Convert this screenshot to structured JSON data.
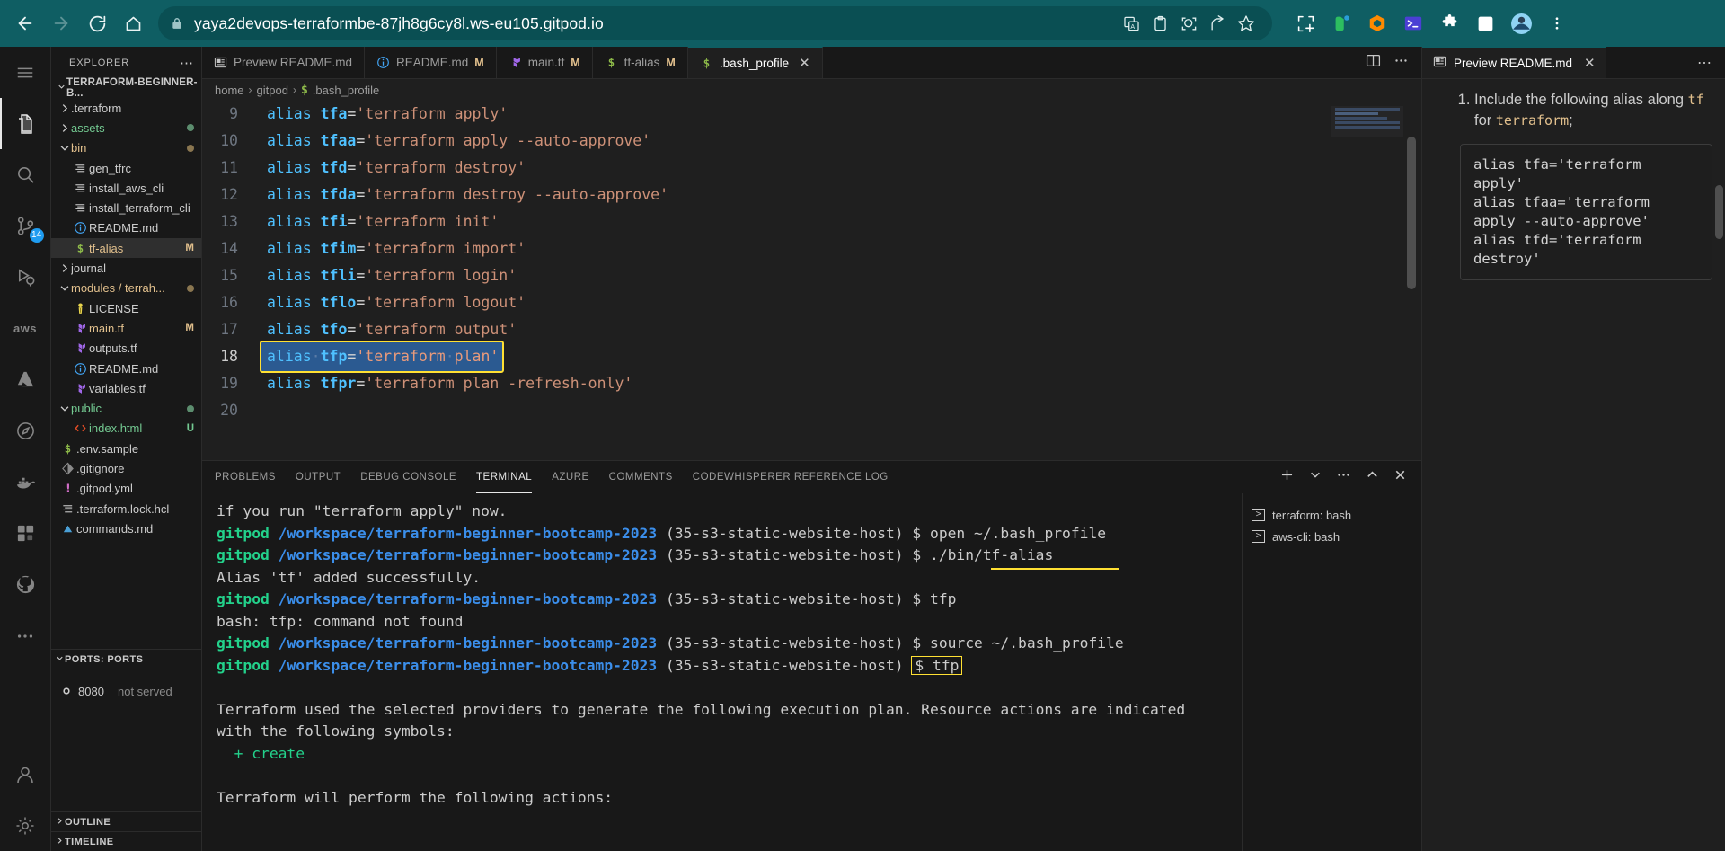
{
  "browser": {
    "url": "yaya2devops-terraformbe-87jh8g6cy8l.ws-eu105.gitpod.io",
    "back_label": "back-arrow",
    "forward_label": "forward-arrow",
    "reload_label": "reload",
    "home_label": "home",
    "icons": [
      "translate-icon",
      "clipboard-icon",
      "lens-icon",
      "share-icon",
      "star-icon",
      "screenshot-icon",
      "evernote-icon",
      "gitpod-icon",
      "terminal-ext-icon",
      "puzzle-icon",
      "sidepanel-icon",
      "profile-avatar-icon",
      "kebab-menu-icon"
    ]
  },
  "activity_bar": {
    "items": [
      {
        "name": "menu",
        "icon": "hamburger-icon"
      },
      {
        "name": "explorer",
        "icon": "files-icon",
        "active": true
      },
      {
        "name": "search",
        "icon": "search-icon"
      },
      {
        "name": "source-control",
        "icon": "source-control-icon",
        "badge": "14"
      },
      {
        "name": "run-debug",
        "icon": "run-debug-icon"
      },
      {
        "name": "aws",
        "icon": "aws-icon",
        "label": "aws"
      },
      {
        "name": "azure",
        "icon": "azure-icon"
      },
      {
        "name": "docker",
        "icon": "docker-icon"
      },
      {
        "name": "coffee",
        "icon": "java-icon"
      },
      {
        "name": "extensions",
        "icon": "extensions-icon"
      },
      {
        "name": "remote",
        "icon": "remote-explorer-icon"
      },
      {
        "name": "more",
        "icon": "ellipsis-icon"
      },
      {
        "name": "accounts",
        "icon": "account-icon"
      },
      {
        "name": "settings",
        "icon": "gear-icon"
      }
    ]
  },
  "sidebar": {
    "title": "EXPLORER",
    "more_label": "⋯",
    "root": "TERRAFORM-BEGINNER-B...",
    "tree": [
      {
        "label": ".terraform",
        "icon": "chevron-right",
        "indent": 1,
        "kind": "folder",
        "color": "white"
      },
      {
        "label": "assets",
        "icon": "chevron-right",
        "indent": 1,
        "kind": "folder",
        "color": "green",
        "dot": "#5c8d6e"
      },
      {
        "label": "bin",
        "icon": "chevron-down",
        "indent": 1,
        "kind": "folder",
        "color": "orange",
        "dot": "#8a7650"
      },
      {
        "label": "gen_tfrc",
        "icon": "script-icon",
        "indent": 2,
        "kind": "file",
        "color": "white"
      },
      {
        "label": "install_aws_cli",
        "icon": "script-icon",
        "indent": 2,
        "kind": "file",
        "color": "white"
      },
      {
        "label": "install_terraform_cli",
        "icon": "script-icon",
        "indent": 2,
        "kind": "file",
        "color": "white"
      },
      {
        "label": "README.md",
        "icon": "info-icon",
        "indent": 2,
        "kind": "file",
        "color": "white"
      },
      {
        "label": "tf-alias",
        "icon": "shell-icon",
        "indent": 2,
        "kind": "file",
        "color": "orange",
        "badge": "M",
        "selected": true
      },
      {
        "label": "journal",
        "icon": "chevron-right",
        "indent": 1,
        "kind": "folder",
        "color": "white"
      },
      {
        "label": "modules / terrah...",
        "icon": "chevron-down",
        "indent": 1,
        "kind": "folder",
        "color": "orange",
        "dot": "#8a7650"
      },
      {
        "label": "LICENSE",
        "icon": "license-icon",
        "indent": 2,
        "kind": "file",
        "color": "white"
      },
      {
        "label": "main.tf",
        "icon": "terraform-icon",
        "indent": 2,
        "kind": "file",
        "color": "orange",
        "badge": "M"
      },
      {
        "label": "outputs.tf",
        "icon": "terraform-icon",
        "indent": 2,
        "kind": "file",
        "color": "white"
      },
      {
        "label": "README.md",
        "icon": "info-icon",
        "indent": 2,
        "kind": "file",
        "color": "white"
      },
      {
        "label": "variables.tf",
        "icon": "terraform-icon",
        "indent": 2,
        "kind": "file",
        "color": "white"
      },
      {
        "label": "public",
        "icon": "chevron-down",
        "indent": 1,
        "kind": "folder",
        "color": "green",
        "dot": "#5c8d6e"
      },
      {
        "label": "index.html",
        "icon": "html-icon",
        "indent": 2,
        "kind": "file",
        "color": "green",
        "badge": "U"
      },
      {
        "label": ".env.sample",
        "icon": "shell-icon",
        "indent": 1,
        "kind": "file",
        "color": "white"
      },
      {
        "label": ".gitignore",
        "icon": "git-icon",
        "indent": 1,
        "kind": "file",
        "color": "white"
      },
      {
        "label": ".gitpod.yml",
        "icon": "yaml-icon",
        "indent": 1,
        "kind": "file",
        "color": "white"
      },
      {
        "label": ".terraform.lock.hcl",
        "icon": "script-icon",
        "indent": 1,
        "kind": "file",
        "color": "white"
      },
      {
        "label": "commands.md",
        "icon": "markdown-icon",
        "indent": 1,
        "kind": "file",
        "color": "white"
      }
    ],
    "ports_header": "PORTS: PORTS",
    "ports": [
      {
        "port": "8080",
        "status": "not served"
      }
    ],
    "outline_header": "OUTLINE",
    "timeline_header": "TIMELINE"
  },
  "editor": {
    "tabs": [
      {
        "label": "Preview README.md",
        "icon": "preview-icon",
        "modified": "",
        "active": false,
        "closable": false
      },
      {
        "label": "README.md",
        "icon": "info-icon",
        "modified": "M",
        "active": false,
        "closable": false
      },
      {
        "label": "main.tf",
        "icon": "terraform-icon",
        "modified": "M",
        "active": false,
        "closable": false
      },
      {
        "label": "tf-alias",
        "icon": "shell-icon",
        "modified": "M",
        "active": false,
        "closable": false
      },
      {
        "label": ".bash_profile",
        "icon": "shell-icon",
        "modified": "",
        "active": true,
        "closable": true
      }
    ],
    "tab_close_glyph": "✕",
    "split_editor_label": "split-editor",
    "more_actions_label": "⋯",
    "breadcrumb": [
      "home",
      "gitpod",
      ".bash_profile"
    ],
    "breadcrumb_icon": "shell-icon",
    "lines": [
      {
        "n": "9",
        "kw": "alias",
        "var": "tfa",
        "str": "'terraform apply'"
      },
      {
        "n": "10",
        "kw": "alias",
        "var": "tfaa",
        "str": "'terraform apply --auto-approve'"
      },
      {
        "n": "11",
        "kw": "alias",
        "var": "tfd",
        "str": "'terraform destroy'"
      },
      {
        "n": "12",
        "kw": "alias",
        "var": "tfda",
        "str": "'terraform destroy --auto-approve'"
      },
      {
        "n": "13",
        "kw": "alias",
        "var": "tfi",
        "str": "'terraform init'"
      },
      {
        "n": "14",
        "kw": "alias",
        "var": "tfim",
        "str": "'terraform import'"
      },
      {
        "n": "15",
        "kw": "alias",
        "var": "tfli",
        "str": "'terraform login'"
      },
      {
        "n": "16",
        "kw": "alias",
        "var": "tflo",
        "str": "'terraform logout'"
      },
      {
        "n": "17",
        "kw": "alias",
        "var": "tfo",
        "str": "'terraform output'"
      },
      {
        "n": "18",
        "kw": "alias",
        "var": "tfp",
        "str": "'terraform plan'",
        "selected": true
      },
      {
        "n": "19",
        "kw": "alias",
        "var": "tfpr",
        "str": "'terraform plan -refresh-only'"
      },
      {
        "n": "20",
        "kw": "",
        "var": "",
        "str": ""
      }
    ]
  },
  "panel": {
    "tabs": [
      {
        "label": "PROBLEMS",
        "active": false
      },
      {
        "label": "OUTPUT",
        "active": false
      },
      {
        "label": "DEBUG CONSOLE",
        "active": false
      },
      {
        "label": "TERMINAL",
        "active": true
      },
      {
        "label": "AZURE",
        "active": false
      },
      {
        "label": "COMMENTS",
        "active": false
      },
      {
        "label": "CODEWHISPERER REFERENCE LOG",
        "active": false
      }
    ],
    "actions": [
      "add-terminal-icon",
      "chevron-down-icon",
      "ellipsis-icon",
      "maximize-panel-icon",
      "close-panel-icon"
    ],
    "terminal": {
      "user": "gitpod",
      "path": "/workspace/terraform-beginner-bootcamp-2023",
      "branch": "(35-s3-static-website-host)",
      "prompt": "$",
      "lines": [
        {
          "type": "plain",
          "text": "if you run \"terraform apply\" now."
        },
        {
          "type": "prompt",
          "cmd": "open ~/.bash_profile"
        },
        {
          "type": "prompt",
          "cmd": "./bin/tf-alias",
          "underline": true
        },
        {
          "type": "plain",
          "text": "Alias 'tf' added successfully."
        },
        {
          "type": "prompt",
          "cmd": "tfp"
        },
        {
          "type": "plain",
          "text": "bash: tfp: command not found"
        },
        {
          "type": "prompt",
          "cmd": "source ~/.bash_profile",
          "underline": true
        },
        {
          "type": "prompt",
          "cmd": "tfp",
          "boxed": true
        },
        {
          "type": "blank",
          "text": ""
        },
        {
          "type": "plain",
          "text": "Terraform used the selected providers to generate the following execution plan. Resource actions are indicated"
        },
        {
          "type": "plain",
          "text": "with the following symbols:"
        },
        {
          "type": "create",
          "text": "  + create"
        },
        {
          "type": "blank",
          "text": ""
        },
        {
          "type": "plain",
          "text": "Terraform will perform the following actions:"
        }
      ]
    },
    "terminal_list": [
      {
        "label": "terraform: bash",
        "icon": "terminal-icon"
      },
      {
        "label": "aws-cli: bash",
        "icon": "terminal-icon"
      }
    ]
  },
  "preview": {
    "tab_label": "Preview README.md",
    "tab_icon": "preview-icon",
    "close_glyph": "✕",
    "more_glyph": "⋯",
    "list_item_parts": [
      "Include the following alias along ",
      "tf",
      " for ",
      "terraform",
      ";"
    ],
    "code_block": "alias tfa='terraform apply'\nalias tfaa='terraform apply --auto-approve'\nalias tfd='terraform destroy'"
  },
  "colors": {
    "browser_bar": "#0f5e63",
    "accent_blue": "#1f9cf0",
    "terminal_green": "#23d18b",
    "terminal_blue": "#3b8eea",
    "highlight_yellow": "#ffe033",
    "selection_blue": "#2b5a91",
    "modified_orange": "#e2c08d",
    "editor_bg": "#1f1f1f",
    "sidebar_bg": "#181818"
  }
}
